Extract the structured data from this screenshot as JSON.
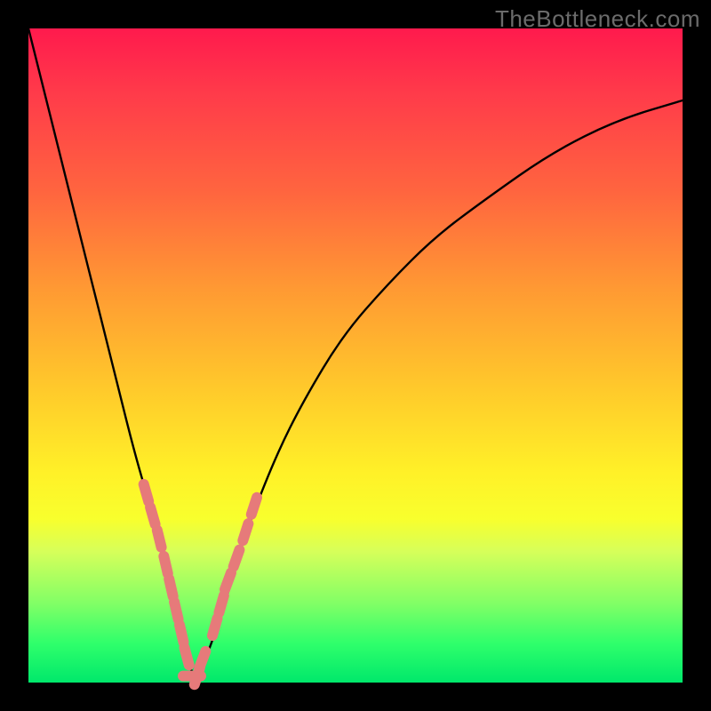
{
  "watermark": {
    "text": "TheBottleneck.com"
  },
  "colors": {
    "curve": "#000000",
    "marker_fill": "#e67a7a",
    "marker_stroke": "#c05a5a"
  },
  "chart_data": {
    "type": "line",
    "title": "",
    "xlabel": "",
    "ylabel": "",
    "xlim": [
      0,
      100
    ],
    "ylim": [
      0,
      100
    ],
    "note": "Gradient background encodes bottleneck severity: red≈100 (bad) at top, green≈0 (good) at bottom. The black curve shows bottleneck % vs x; it dips to ~0 near x≈25 and rises on both sides. Coral markers highlight sampled points near the minimum.",
    "series": [
      {
        "name": "bottleneck-curve",
        "x": [
          0,
          2,
          4,
          6,
          8,
          10,
          12,
          14,
          16,
          18,
          20,
          22,
          24,
          25,
          26,
          28,
          30,
          32,
          34,
          38,
          42,
          48,
          55,
          62,
          70,
          80,
          90,
          100
        ],
        "y": [
          100,
          92,
          84,
          76,
          68,
          60,
          52,
          44,
          36,
          29,
          22,
          14,
          6,
          1,
          1,
          6,
          12,
          19,
          25,
          35,
          43,
          53,
          61,
          68,
          74,
          81,
          86,
          89
        ]
      }
    ],
    "markers": {
      "name": "highlighted-points",
      "x": [
        18.0,
        19.0,
        20.0,
        21.0,
        21.8,
        22.6,
        23.4,
        24.2,
        25.0,
        25.8,
        26.6,
        28.5,
        29.5,
        30.5,
        31.8,
        33.2,
        34.5
      ],
      "y": [
        29.0,
        25.5,
        22.0,
        18.0,
        14.5,
        11.0,
        7.5,
        4.0,
        1.0,
        1.0,
        3.5,
        8.5,
        12.0,
        15.5,
        19.0,
        23.0,
        27.0
      ]
    }
  }
}
